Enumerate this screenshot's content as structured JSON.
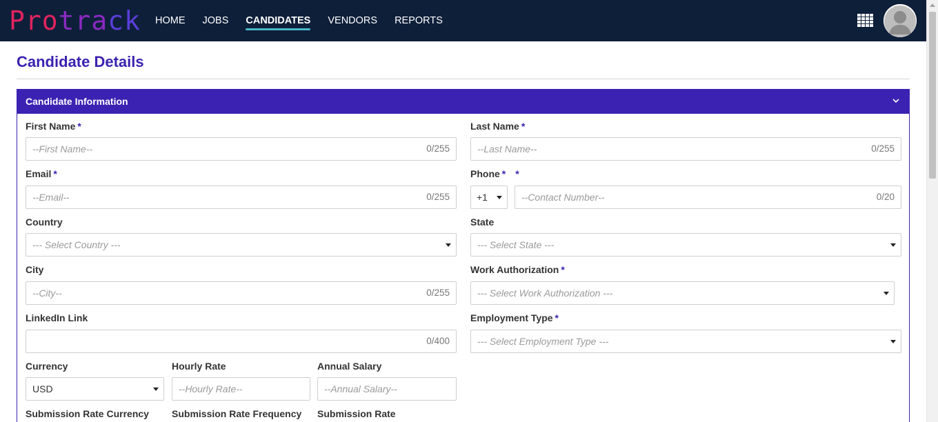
{
  "logo": {
    "part1": "Pro",
    "part2": "tra",
    "part3": "ck"
  },
  "nav": {
    "items": [
      {
        "label": "HOME"
      },
      {
        "label": "JOBS"
      },
      {
        "label": "CANDIDATES"
      },
      {
        "label": "VENDORS"
      },
      {
        "label": "REPORTS"
      }
    ],
    "active": "CANDIDATES"
  },
  "page": {
    "title": "Candidate Details"
  },
  "panel": {
    "title": "Candidate Information"
  },
  "form": {
    "required_mark": "*",
    "first_name": {
      "label": "First Name",
      "placeholder": "--First Name--",
      "counter": "0/255"
    },
    "last_name": {
      "label": "Last Name",
      "placeholder": "--Last Name--",
      "counter": "0/255"
    },
    "email": {
      "label": "Email",
      "placeholder": "--Email--",
      "counter": "0/255"
    },
    "phone": {
      "label": "Phone",
      "code": "+1",
      "placeholder": "--Contact Number--",
      "counter": "0/20"
    },
    "country": {
      "label": "Country",
      "placeholder": "--- Select Country ---"
    },
    "state": {
      "label": "State",
      "placeholder": "--- Select State ---"
    },
    "city": {
      "label": "City",
      "placeholder": "--City--",
      "counter": "0/255"
    },
    "work_authorization": {
      "label": "Work Authorization",
      "placeholder": "--- Select Work Authorization ---"
    },
    "linkedin": {
      "label": "LinkedIn Link",
      "counter": "0/400"
    },
    "employment_type": {
      "label": "Employment Type",
      "placeholder": "--- Select Employment Type ---"
    },
    "currency": {
      "label": "Currency",
      "value": "USD"
    },
    "hourly_rate": {
      "label": "Hourly Rate",
      "placeholder": "--Hourly Rate--"
    },
    "annual_salary": {
      "label": "Annual Salary",
      "placeholder": "--Annual Salary--"
    },
    "submission_rate_currency": {
      "label": "Submission Rate Currency"
    },
    "submission_rate_frequency": {
      "label": "Submission Rate Frequency"
    },
    "submission_rate": {
      "label": "Submission Rate"
    }
  },
  "colors": {
    "topbar": "#0e1f3a",
    "accent": "#3b22b2",
    "nav_underline": "#4bb8c9"
  },
  "icons": {
    "apps": "grid-icon",
    "avatar": "user-avatar-icon",
    "collapse": "chevron-down-icon"
  }
}
